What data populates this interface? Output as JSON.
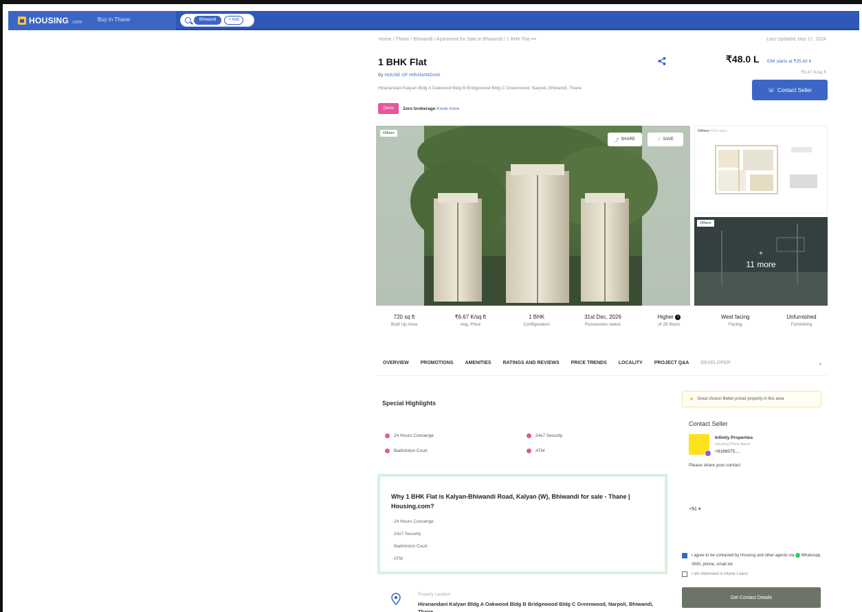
{
  "header": {
    "logo": "HOUSING",
    "logo_suffix": ".com",
    "city": "Buy in Thane",
    "search_chip": "Bhiwandi",
    "add_chip": "+ Add"
  },
  "breadcrumb": "Home / Thane / Bhiwandi / Apartment for Sale in Bhiwandi / 1 BHK Flat",
  "breadcrumb_more": "•••",
  "last_updated": "Last Updated: Mar 17, 2024",
  "listing": {
    "title": "1 BHK Flat",
    "by_prefix": "By",
    "builder": "HOUSE OF HIRANANDANI",
    "address": "Hiranandani Kalyan Bldg A Oakwood Bldg B Bridgewood Bldg C Greenwood, Narpoli, Bhiwandi, Thane",
    "tag": "Gems",
    "zero_brokerage": "Zero brokerage",
    "know_more": "Know more",
    "price": "₹48.0 L",
    "emi": "EMI starts at ₹25.42 K",
    "per_sqft": "₹6.67 K/sq ft",
    "contact_seller": "Contact Seller"
  },
  "gallery": {
    "main_tag": "Others",
    "share": "SHARE",
    "save": "SAVE",
    "plan_tag": "Others",
    "plan_sub": "Floor plan",
    "more_tag": "Others",
    "more_plus": "+",
    "more_label": "11 more"
  },
  "stats": [
    {
      "value": "720 sq ft",
      "label": "Built Up Area"
    },
    {
      "value": "₹6.67 K/sq ft",
      "label": "Avg. Price"
    },
    {
      "value": "1 BHK",
      "label": "Configuration"
    },
    {
      "value": "31st Dec, 2026",
      "label": "Possession status"
    },
    {
      "value": "Higher",
      "label": "of 25 floors"
    },
    {
      "value": "West facing",
      "label": "Facing"
    },
    {
      "value": "Unfurnished",
      "label": "Furnishing"
    }
  ],
  "tabs": [
    "OVERVIEW",
    "PROMOTIONS",
    "AMENITIES",
    "RATINGS AND REVIEWS",
    "PRICE TRENDS",
    "LOCALITY",
    "PROJECT Q&A",
    "DEVELOPER"
  ],
  "tab_next": "›",
  "highlights": {
    "title": "Special Highlights",
    "items": [
      "24 Hours Concierge",
      "24x7 Security",
      "Badminton Court",
      "ATM"
    ]
  },
  "why": {
    "title": "Why 1 BHK Flat is Kalyan-Bhiwandi Road, Kalyan (W), Bhiwandi for sale - Thane | Housing.com?",
    "items": [
      "24 Hours Concierge",
      "24x7 Security",
      "Badminton Court",
      "ATM"
    ]
  },
  "location": {
    "label": "Property Location",
    "text": "Hiranandani Kalyan Bldg A Oakwood Bldg B Bridgewood Bldg C Greenwood, Narpoli, Bhiwandi, Thane"
  },
  "sidebar": {
    "choice": "Great choice! Better priced property in this area",
    "contact_title": "Contact Seller",
    "seller_name": "Infinity Properties",
    "seller_role": "Housing Prime Agent",
    "seller_phone": "+9166575....",
    "share_contact": "Please share your contact",
    "phone_prefix": "+91 ▾",
    "consent_a": "I agree to be contacted by Housing and other agents via",
    "consent_b": "WhatsApp, SMS, phone, email etc",
    "home_loans": "I am interested in Home Loans",
    "get_details": "Get Contact Details"
  },
  "colors": {
    "brand": "#3c66c6",
    "pink": "#e4579a",
    "highlight_border": "#d7f1de"
  }
}
